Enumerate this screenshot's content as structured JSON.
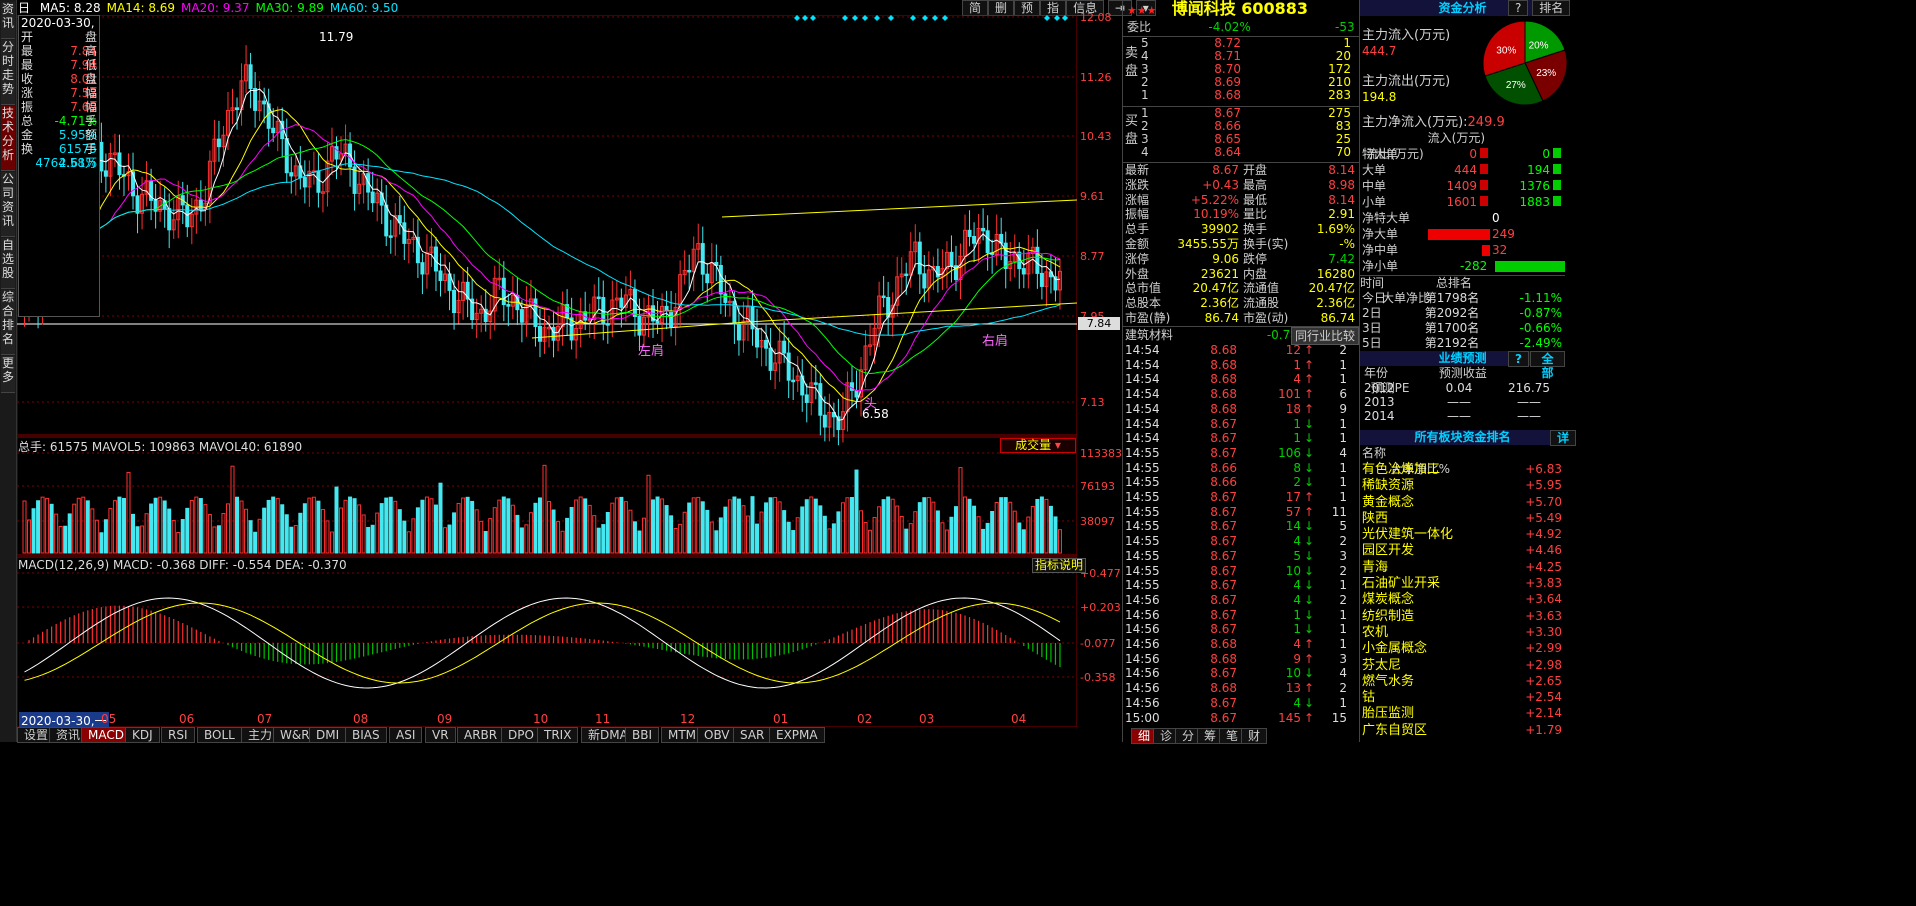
{
  "toolbar": {
    "left_tabs": [
      {
        "label": "资讯"
      },
      {
        "label": "分时走势"
      },
      {
        "label": "技术分析"
      },
      {
        "label": "公司资讯"
      },
      {
        "label": "自选股"
      },
      {
        "label": "综合排名"
      },
      {
        "label": "更多"
      }
    ],
    "top_right_buttons": [
      "简",
      "删",
      "预",
      "指",
      "信息"
    ]
  },
  "kline": {
    "period": "日",
    "ma_labels": [
      {
        "name": "MA5",
        "value": "8.28",
        "color": "#ffffff"
      },
      {
        "name": "MA14",
        "value": "8.69",
        "color": "#ffff00"
      },
      {
        "name": "MA20",
        "value": "9.37",
        "color": "#ff00ff"
      },
      {
        "name": "MA30",
        "value": "9.89",
        "color": "#00ff00"
      },
      {
        "name": "MA60",
        "value": "9.50",
        "color": "#00e5ff"
      }
    ],
    "ohlc_box": {
      "date": "2020-03-30,一",
      "rows": [
        {
          "label": "开盘",
          "value": "7.84"
        },
        {
          "label": "最高",
          "value": "7.94"
        },
        {
          "label": "最低",
          "value": "8.01"
        },
        {
          "label": "收盘",
          "value": "7.53"
        },
        {
          "label": "涨幅",
          "value": "7.69"
        },
        {
          "label": "振幅",
          "value": "-4.71%"
        },
        {
          "label": "总手",
          "value": "5.95%"
        },
        {
          "label": "金额",
          "value": "61575"
        },
        {
          "label": "换手",
          "value": "4764.58万"
        },
        {
          "label": "",
          "value": "2.61%"
        }
      ]
    },
    "price_axis": [
      "12.08",
      "11.26",
      "10.43",
      "9.61",
      "8.77",
      "7.95",
      "7.13"
    ],
    "annotations": {
      "left_shoulder": "左肩",
      "right_shoulder": "右肩",
      "head": "头",
      "high_label": "11.79",
      "low_label": "6.58",
      "current": "7.84"
    }
  },
  "volume": {
    "labels": "总手: 61575 MAVOL5: 109863 MAVOL40: 61890",
    "axis": [
      "113383",
      "76193",
      "38097"
    ],
    "selector": "成交量"
  },
  "macd": {
    "labels": "MACD(12,26,9) MACD: -0.368 DIFF: -0.554 DEA: -0.370",
    "axis": [
      "+0.477",
      "+0.203",
      "-0.077",
      "-0.358"
    ],
    "button": "指标说明"
  },
  "xaxis": {
    "cursor_date": "2020-03-30,一",
    "months": [
      "05",
      "06",
      "07",
      "08",
      "09",
      "10",
      "11",
      "12",
      "01",
      "02",
      "03",
      "04"
    ]
  },
  "bottom_tabs": [
    "设置",
    "资讯",
    "MACD",
    "KDJ",
    "RSI",
    "BOLL",
    "主力",
    "W&R",
    "DMI",
    "BIAS",
    "ASI",
    "VR",
    "ARBR",
    "DPO",
    "TRIX",
    "新DMA",
    "BBI",
    "MTM",
    "OBV",
    "SAR",
    "EXPMA"
  ],
  "quote": {
    "title": "博闻科技 600883",
    "stars": "★★★",
    "weibi": {
      "label": "委比",
      "pct": "-4.02%",
      "diff": "-53"
    },
    "sell": [
      {
        "lvl": "5",
        "price": "8.72",
        "vol": "1"
      },
      {
        "lvl": "4",
        "price": "8.71",
        "vol": "20"
      },
      {
        "lvl": "3",
        "price": "8.70",
        "vol": "172"
      },
      {
        "lvl": "2",
        "price": "8.69",
        "vol": "210"
      },
      {
        "lvl": "1",
        "price": "8.68",
        "vol": "283"
      }
    ],
    "buy": [
      {
        "lvl": "1",
        "price": "8.67",
        "vol": "275"
      },
      {
        "lvl": "2",
        "price": "8.66",
        "vol": "83"
      },
      {
        "lvl": "3",
        "price": "8.65",
        "vol": "25"
      },
      {
        "lvl": "4",
        "price": "8.64",
        "vol": "70"
      }
    ],
    "sell_label": "卖盘",
    "buy_label": "买盘",
    "stats": [
      {
        "l1": "最新",
        "v1": "8.67",
        "l2": "开盘",
        "v2": "8.14"
      },
      {
        "l1": "涨跌",
        "v1": "+0.43",
        "l2": "最高",
        "v2": "8.98"
      },
      {
        "l1": "涨幅",
        "v1": "+5.22%",
        "l2": "最低",
        "v2": "8.14"
      },
      {
        "l1": "振幅",
        "v1": "10.19%",
        "l2": "量比",
        "v2": "2.91"
      },
      {
        "l1": "总手",
        "v1": "39902",
        "l2": "换手",
        "v2": "1.69%"
      },
      {
        "l1": "金额",
        "v1": "3455.55万",
        "l2": "换手(实)",
        "v2": "-%"
      },
      {
        "l1": "涨停",
        "v1": "9.06",
        "l2": "跌停",
        "v2": "7.42"
      },
      {
        "l1": "外盘",
        "v1": "23621",
        "l2": "内盘",
        "v2": "16280"
      },
      {
        "l1": "总市值",
        "v1": "20.47亿",
        "l2": "流通值",
        "v2": "20.47亿"
      },
      {
        "l1": "总股本",
        "v1": "2.36亿",
        "l2": "流通股",
        "v2": "2.36亿"
      },
      {
        "l1": "市盈(静)",
        "v1": "86.74",
        "l2": "市盈(动)",
        "v2": "86.74"
      }
    ],
    "industry": {
      "name": "建筑材料",
      "pct": "-0.74%",
      "compare": "同行业比较"
    },
    "ticks": [
      {
        "t": "14:54",
        "p": "8.68",
        "v": "12",
        "d": "up",
        "n": "2"
      },
      {
        "t": "14:54",
        "p": "8.68",
        "v": "1",
        "d": "up",
        "n": "1"
      },
      {
        "t": "14:54",
        "p": "8.68",
        "v": "4",
        "d": "up",
        "n": "1"
      },
      {
        "t": "14:54",
        "p": "8.68",
        "v": "101",
        "d": "up",
        "n": "6"
      },
      {
        "t": "14:54",
        "p": "8.68",
        "v": "18",
        "d": "up",
        "n": "9"
      },
      {
        "t": "14:54",
        "p": "8.67",
        "v": "1",
        "d": "down",
        "n": "1"
      },
      {
        "t": "14:54",
        "p": "8.67",
        "v": "1",
        "d": "down",
        "n": "1"
      },
      {
        "t": "14:55",
        "p": "8.67",
        "v": "106",
        "d": "down",
        "n": "4"
      },
      {
        "t": "14:55",
        "p": "8.66",
        "v": "8",
        "d": "down",
        "n": "1"
      },
      {
        "t": "14:55",
        "p": "8.66",
        "v": "2",
        "d": "down",
        "n": "1"
      },
      {
        "t": "14:55",
        "p": "8.67",
        "v": "17",
        "d": "up",
        "n": "1"
      },
      {
        "t": "14:55",
        "p": "8.67",
        "v": "57",
        "d": "up",
        "n": "11"
      },
      {
        "t": "14:55",
        "p": "8.67",
        "v": "14",
        "d": "down",
        "n": "5"
      },
      {
        "t": "14:55",
        "p": "8.67",
        "v": "4",
        "d": "down",
        "n": "2"
      },
      {
        "t": "14:55",
        "p": "8.67",
        "v": "5",
        "d": "down",
        "n": "3"
      },
      {
        "t": "14:55",
        "p": "8.67",
        "v": "10",
        "d": "down",
        "n": "2"
      },
      {
        "t": "14:55",
        "p": "8.67",
        "v": "4",
        "d": "down",
        "n": "1"
      },
      {
        "t": "14:56",
        "p": "8.67",
        "v": "4",
        "d": "down",
        "n": "2"
      },
      {
        "t": "14:56",
        "p": "8.67",
        "v": "1",
        "d": "down",
        "n": "1"
      },
      {
        "t": "14:56",
        "p": "8.67",
        "v": "1",
        "d": "down",
        "n": "1"
      },
      {
        "t": "14:56",
        "p": "8.68",
        "v": "4",
        "d": "up",
        "n": "1"
      },
      {
        "t": "14:56",
        "p": "8.68",
        "v": "9",
        "d": "up",
        "n": "3"
      },
      {
        "t": "14:56",
        "p": "8.67",
        "v": "10",
        "d": "down",
        "n": "4"
      },
      {
        "t": "14:56",
        "p": "8.68",
        "v": "13",
        "d": "up",
        "n": "2"
      },
      {
        "t": "14:56",
        "p": "8.67",
        "v": "4",
        "d": "down",
        "n": "1"
      },
      {
        "t": "15:00",
        "p": "8.67",
        "v": "145",
        "d": "up",
        "n": "15"
      }
    ],
    "bottom_tabs": [
      "细",
      "诊",
      "分",
      "筹",
      "笔",
      "财"
    ]
  },
  "fund": {
    "header": "资金分析",
    "btns": [
      "?",
      "排名"
    ],
    "inflow_label": "主力流入(万元)",
    "inflow": "444.7",
    "outflow_label": "主力流出(万元)",
    "outflow": "194.8",
    "net_label": "主力净流入(万元):",
    "net": "249.9",
    "pie": [
      {
        "label": "20%",
        "value": 20,
        "color": "#009900"
      },
      {
        "label": "23%",
        "value": 23,
        "color": "#7a0000"
      },
      {
        "label": "27%",
        "value": 27,
        "color": "#005000"
      },
      {
        "label": "30%",
        "value": 30,
        "color": "#c80000"
      }
    ],
    "table_hdr": {
      "in": "流入(万元)",
      "out": "流出(万元)"
    },
    "table": [
      {
        "name": "特大单",
        "in": "0",
        "out": "0"
      },
      {
        "name": "大单",
        "in": "444",
        "out": "194"
      },
      {
        "name": "中单",
        "in": "1409",
        "out": "1376"
      },
      {
        "name": "小单",
        "in": "1601",
        "out": "1883"
      }
    ],
    "net_rows": [
      {
        "name": "净特大单",
        "value": "0",
        "level": 0
      },
      {
        "name": "净大单",
        "value": "249",
        "level": 250
      },
      {
        "name": "净中单",
        "value": "32",
        "level": 32
      },
      {
        "name": "净小单",
        "value": "-282",
        "level": -282
      }
    ],
    "rank_hdr": {
      "time": "时间",
      "rank": "总排名",
      "net": "大单净比"
    },
    "rank": [
      {
        "time": "今日",
        "rank": "第1798名",
        "net": "-1.11%"
      },
      {
        "time": "2日",
        "rank": "第2092名",
        "net": "-0.87%"
      },
      {
        "time": "3日",
        "rank": "第1700名",
        "net": "-0.66%"
      },
      {
        "time": "5日",
        "rank": "第2192名",
        "net": "-2.49%"
      }
    ]
  },
  "forecast": {
    "header": "业绩预测",
    "btns": [
      "?",
      "全部"
    ],
    "cols": [
      "年份",
      "预测收益",
      "预测PE"
    ],
    "rows": [
      {
        "year": "2012",
        "eps": "0.04",
        "pe": "216.75"
      },
      {
        "year": "2013",
        "eps": "——",
        "pe": "——"
      },
      {
        "year": "2014",
        "eps": "——",
        "pe": "——"
      }
    ]
  },
  "sectors": {
    "header": "所有板块资金排名",
    "btn": "详",
    "cols": [
      "名称",
      "大单净比%"
    ],
    "rows": [
      {
        "name": "有色冶炼加工",
        "v": "+6.83"
      },
      {
        "name": "稀缺资源",
        "v": "+5.95"
      },
      {
        "name": "黄金概念",
        "v": "+5.70"
      },
      {
        "name": "陕西",
        "v": "+5.49"
      },
      {
        "name": "光伏建筑一体化",
        "v": "+4.92"
      },
      {
        "name": "园区开发",
        "v": "+4.46"
      },
      {
        "name": "青海",
        "v": "+4.25"
      },
      {
        "name": "石油矿业开采",
        "v": "+3.83"
      },
      {
        "name": "煤炭概念",
        "v": "+3.64"
      },
      {
        "name": "纺织制造",
        "v": "+3.63"
      },
      {
        "name": "农机",
        "v": "+3.30"
      },
      {
        "name": "小金属概念",
        "v": "+2.99"
      },
      {
        "name": "芬太尼",
        "v": "+2.98"
      },
      {
        "name": "燃气水务",
        "v": "+2.65"
      },
      {
        "name": "钴",
        "v": "+2.54"
      },
      {
        "name": "胎压监测",
        "v": "+2.14"
      },
      {
        "name": "广东自贸区",
        "v": "+1.79"
      }
    ]
  },
  "chart_data": {
    "type": "candlestick",
    "dates_months": [
      "05",
      "06",
      "07",
      "08",
      "09",
      "10",
      "11",
      "12",
      "01",
      "02",
      "03",
      "04"
    ],
    "close_approx": [
      8.1,
      8.6,
      9.2,
      9.9,
      10.3,
      10.1,
      9.8,
      9.6,
      9.5,
      9.4,
      9.8,
      10.7,
      11.2,
      11.0,
      10.4,
      10.0,
      9.8,
      10.3,
      10.1,
      9.7,
      9.4,
      9.1,
      8.9,
      8.6,
      8.3,
      8.1,
      8.4,
      8.3,
      8.0,
      7.9,
      8.0,
      8.1,
      8.2,
      8.3,
      8.1,
      8.0,
      8.4,
      9.0,
      8.6,
      8.1,
      7.9,
      7.6,
      7.4,
      7.1,
      6.8,
      6.7,
      7.4,
      8.1,
      8.5,
      8.9,
      8.6,
      8.8,
      9.1,
      9.2,
      8.8,
      8.9,
      8.6,
      8.7
    ],
    "ylim": [
      6.5,
      12.1
    ],
    "macd_axis": [
      0.477,
      0.203,
      -0.077,
      -0.358
    ]
  }
}
